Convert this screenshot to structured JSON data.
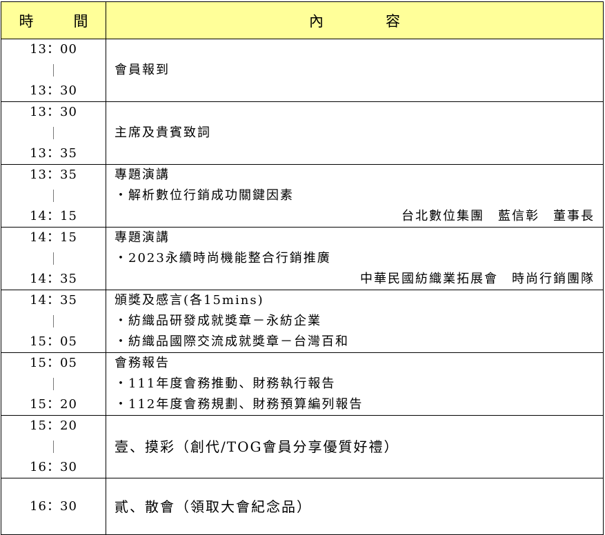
{
  "header": {
    "time_char_1": "時",
    "time_char_2": "間",
    "content_char_1": "內",
    "content_char_2": "容"
  },
  "rows": [
    {
      "start": "13：00",
      "end": "13：30",
      "lines": [
        "會員報到"
      ]
    },
    {
      "start": "13：30",
      "end": "13：35",
      "lines": [
        "主席及貴賓致詞"
      ]
    },
    {
      "start": "13：35",
      "end": "14：15",
      "lines": [
        "專題演講",
        "・解析數位行銷成功關鍵因素"
      ],
      "speaker": "台北數位集團　藍信彰　董事長"
    },
    {
      "start": "14：15",
      "end": "14：35",
      "lines": [
        "專題演講",
        "・2023永續時尚機能整合行銷推廣"
      ],
      "speaker": "中華民國紡織業拓展會　時尚行銷團隊"
    },
    {
      "start": "14：35",
      "end": "15：05",
      "lines": [
        "頒獎及感言(各15mins)",
        "・紡織品研發成就獎章－永紡企業",
        "・紡織品國際交流成就獎章－台灣百和"
      ]
    },
    {
      "start": "15：05",
      "end": "15：20",
      "lines": [
        "會務報告",
        "・111年度會務推動、財務執行報告",
        "・112年度會務規劃、財務預算編列報告"
      ]
    },
    {
      "start": "15：20",
      "end": "16：30",
      "lines": [
        "壹、摸彩（創代/TOG會員分享優質好禮）"
      ]
    },
    {
      "start": "16：30",
      "lines": [
        "貳、散會（領取大會紀念品）"
      ]
    }
  ]
}
